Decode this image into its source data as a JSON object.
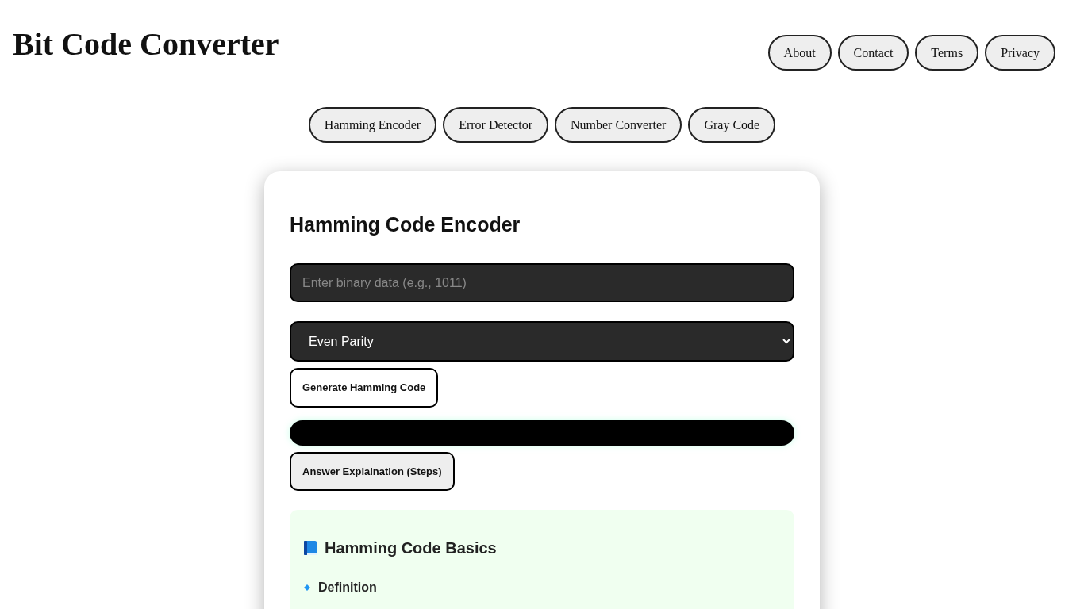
{
  "site_title": "Bit Code Converter",
  "nav_links": [
    "About",
    "Contact",
    "Terms",
    "Privacy"
  ],
  "tools": [
    "Hamming Encoder",
    "Error Detector",
    "Number Converter",
    "Gray Code"
  ],
  "card": {
    "title": "Hamming Code Encoder",
    "input": {
      "placeholder": "Enter binary data (e.g., 1011)"
    },
    "parity_select": {
      "value": "Even Parity"
    },
    "generate_button": "Generate Hamming Code",
    "explain_button": "Answer Explaination (Steps)",
    "info": {
      "heading": "Hamming Code Basics",
      "subheading": "Definition"
    }
  }
}
